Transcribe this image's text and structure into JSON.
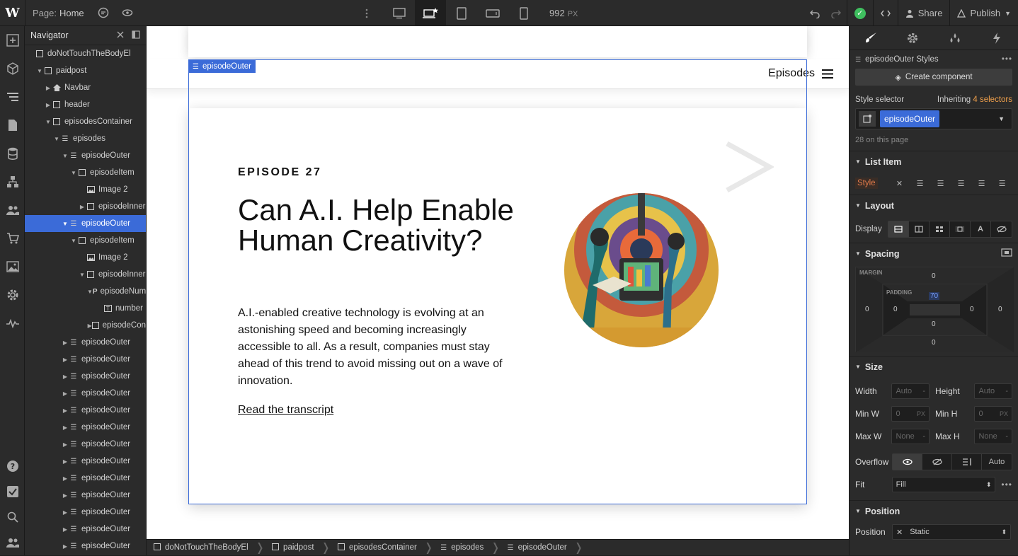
{
  "topbar": {
    "logo": "W",
    "page_prefix": "Page:",
    "page_name": "Home",
    "width_value": "992",
    "width_unit": "PX",
    "share_label": "Share",
    "publish_label": "Publish"
  },
  "navigator": {
    "title": "Navigator",
    "items": [
      {
        "label": "doNotTouchTheBodyEl",
        "indent": 0,
        "icon": "box",
        "caret": ""
      },
      {
        "label": "paidpost",
        "indent": 1,
        "icon": "box",
        "caret": "▼"
      },
      {
        "label": "Navbar",
        "indent": 2,
        "icon": "home",
        "caret": "▶"
      },
      {
        "label": "header",
        "indent": 2,
        "icon": "box",
        "caret": "▶"
      },
      {
        "label": "episodesContainer",
        "indent": 2,
        "icon": "box",
        "caret": "▼"
      },
      {
        "label": "episodes",
        "indent": 3,
        "icon": "list",
        "caret": "▼"
      },
      {
        "label": "episodeOuter",
        "indent": 4,
        "icon": "list",
        "caret": "▼"
      },
      {
        "label": "episodeItem",
        "indent": 5,
        "icon": "box",
        "caret": "▼"
      },
      {
        "label": "Image 2",
        "indent": 6,
        "icon": "image",
        "caret": ""
      },
      {
        "label": "episodeInner",
        "indent": 6,
        "icon": "box",
        "caret": "▶"
      },
      {
        "label": "episodeOuter",
        "indent": 4,
        "icon": "list",
        "caret": "▼",
        "selected": true
      },
      {
        "label": "episodeItem",
        "indent": 5,
        "icon": "box",
        "caret": "▼"
      },
      {
        "label": "Image 2",
        "indent": 6,
        "icon": "image",
        "caret": ""
      },
      {
        "label": "episodeInner",
        "indent": 6,
        "icon": "box",
        "caret": "▼"
      },
      {
        "label": "episodeNum",
        "indent": 7,
        "icon": "para",
        "caret": "▼"
      },
      {
        "label": "number",
        "indent": 8,
        "icon": "text",
        "caret": ""
      },
      {
        "label": "episodeCon",
        "indent": 7,
        "icon": "box",
        "caret": "▶"
      },
      {
        "label": "episodeOuter",
        "indent": 4,
        "icon": "list",
        "caret": "▶"
      },
      {
        "label": "episodeOuter",
        "indent": 4,
        "icon": "list",
        "caret": "▶"
      },
      {
        "label": "episodeOuter",
        "indent": 4,
        "icon": "list",
        "caret": "▶"
      },
      {
        "label": "episodeOuter",
        "indent": 4,
        "icon": "list",
        "caret": "▶"
      },
      {
        "label": "episodeOuter",
        "indent": 4,
        "icon": "list",
        "caret": "▶"
      },
      {
        "label": "episodeOuter",
        "indent": 4,
        "icon": "list",
        "caret": "▶"
      },
      {
        "label": "episodeOuter",
        "indent": 4,
        "icon": "list",
        "caret": "▶"
      },
      {
        "label": "episodeOuter",
        "indent": 4,
        "icon": "list",
        "caret": "▶"
      },
      {
        "label": "episodeOuter",
        "indent": 4,
        "icon": "list",
        "caret": "▶"
      },
      {
        "label": "episodeOuter",
        "indent": 4,
        "icon": "list",
        "caret": "▶"
      },
      {
        "label": "episodeOuter",
        "indent": 4,
        "icon": "list",
        "caret": "▶"
      },
      {
        "label": "episodeOuter",
        "indent": 4,
        "icon": "list",
        "caret": "▶"
      },
      {
        "label": "episodeOuter",
        "indent": 4,
        "icon": "list",
        "caret": "▶"
      }
    ]
  },
  "canvas": {
    "selected_tag": "episodeOuter",
    "nav_link": "Episodes",
    "episode_number": "EPISODE 27",
    "episode_title": "Can A.I. Help Enable Human Creativity?",
    "episode_description": "A.I.-enabled creative technology is evolving at an astonishing speed and becoming increasingly accessible to all. As a result, companies must stay ahead of this trend to avoid missing out on a wave of innovation.",
    "transcript_link": "Read the transcript"
  },
  "breadcrumb": [
    "doNotTouchTheBodyEl",
    "paidpost",
    "episodesContainer",
    "episodes",
    "episodeOuter"
  ],
  "style_panel": {
    "styles_title": "episodeOuter Styles",
    "create_component": "Create component",
    "style_selector_label": "Style selector",
    "inheriting_prefix": "Inheriting",
    "inheriting_count": "4 selectors",
    "selector_chip": "episodeOuter",
    "on_page": "28 on this page",
    "list_item_title": "List Item",
    "style_label": "Style",
    "layout_title": "Layout",
    "display_label": "Display",
    "spacing_title": "Spacing",
    "margin_label": "MARGIN",
    "padding_label": "PADDING",
    "margin_top": "0",
    "margin_left": "0",
    "margin_right": "0",
    "margin_bottom": "0",
    "padding_top": "70",
    "padding_left": "0",
    "padding_right": "0",
    "padding_bottom": "0",
    "size_title": "Size",
    "width_label": "Width",
    "width_value": "Auto",
    "height_label": "Height",
    "height_value": "Auto",
    "minw_label": "Min W",
    "minw_value": "0",
    "minw_unit": "PX",
    "minh_label": "Min H",
    "minh_value": "0",
    "minh_unit": "PX",
    "maxw_label": "Max W",
    "maxw_value": "None",
    "maxh_label": "Max H",
    "maxh_value": "None",
    "unit_dash": "-",
    "overflow_label": "Overflow",
    "overflow_auto": "Auto",
    "fit_label": "Fit",
    "fit_value": "Fill",
    "position_title": "Position",
    "position_label": "Position",
    "position_value": "Static"
  },
  "colors": {
    "accent": "#3b6bd8",
    "orange_selectors": "#f0a04b",
    "publish_ok": "#3fbf5f"
  }
}
